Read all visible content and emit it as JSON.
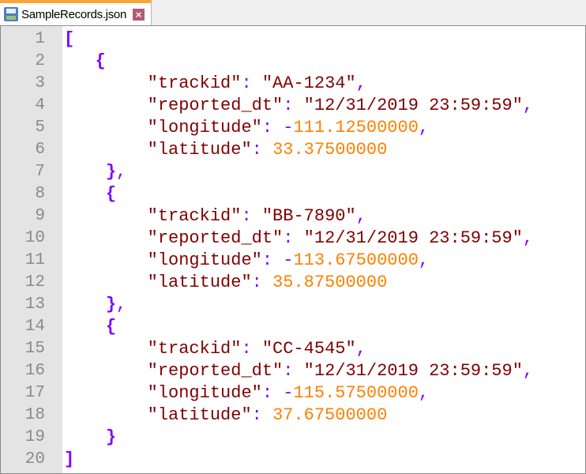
{
  "tab": {
    "title": "SampleRecords.json",
    "icon": "save-disk-icon",
    "close_icon": "close-icon"
  },
  "colors": {
    "brace": "#8000ff",
    "string": "#800000",
    "number": "#ff8000",
    "tab_accent": "#f9a43a"
  },
  "lines": [
    {
      "n": "1",
      "tokens": [
        [
          "brace",
          "["
        ]
      ]
    },
    {
      "n": "2",
      "tokens": [
        [
          "plain",
          "   "
        ],
        [
          "brace",
          "{"
        ]
      ]
    },
    {
      "n": "3",
      "tokens": [
        [
          "plain",
          "        "
        ],
        [
          "key",
          "\"trackid\""
        ],
        [
          "punc",
          ": "
        ],
        [
          "str",
          "\"AA-1234\""
        ],
        [
          "punc",
          ","
        ]
      ]
    },
    {
      "n": "4",
      "tokens": [
        [
          "plain",
          "        "
        ],
        [
          "key",
          "\"reported_dt\""
        ],
        [
          "punc",
          ": "
        ],
        [
          "str",
          "\"12/31/2019 23:59:59\""
        ],
        [
          "punc",
          ","
        ]
      ]
    },
    {
      "n": "5",
      "tokens": [
        [
          "plain",
          "        "
        ],
        [
          "key",
          "\"longitude\""
        ],
        [
          "punc",
          ": -"
        ],
        [
          "num",
          "111.12500000"
        ],
        [
          "punc",
          ","
        ]
      ]
    },
    {
      "n": "6",
      "tokens": [
        [
          "plain",
          "        "
        ],
        [
          "key",
          "\"latitude\""
        ],
        [
          "punc",
          ": "
        ],
        [
          "num",
          "33.37500000"
        ]
      ]
    },
    {
      "n": "7",
      "tokens": [
        [
          "plain",
          "    "
        ],
        [
          "brace",
          "}"
        ],
        [
          "punc",
          ","
        ]
      ]
    },
    {
      "n": "8",
      "tokens": [
        [
          "plain",
          "    "
        ],
        [
          "brace",
          "{"
        ]
      ]
    },
    {
      "n": "9",
      "tokens": [
        [
          "plain",
          "        "
        ],
        [
          "key",
          "\"trackid\""
        ],
        [
          "punc",
          ": "
        ],
        [
          "str",
          "\"BB-7890\""
        ],
        [
          "punc",
          ","
        ]
      ]
    },
    {
      "n": "10",
      "tokens": [
        [
          "plain",
          "        "
        ],
        [
          "key",
          "\"reported_dt\""
        ],
        [
          "punc",
          ": "
        ],
        [
          "str",
          "\"12/31/2019 23:59:59\""
        ],
        [
          "punc",
          ","
        ]
      ]
    },
    {
      "n": "11",
      "tokens": [
        [
          "plain",
          "        "
        ],
        [
          "key",
          "\"longitude\""
        ],
        [
          "punc",
          ": -"
        ],
        [
          "num",
          "113.67500000"
        ],
        [
          "punc",
          ","
        ]
      ]
    },
    {
      "n": "12",
      "tokens": [
        [
          "plain",
          "        "
        ],
        [
          "key",
          "\"latitude\""
        ],
        [
          "punc",
          ": "
        ],
        [
          "num",
          "35.87500000"
        ]
      ]
    },
    {
      "n": "13",
      "tokens": [
        [
          "plain",
          "    "
        ],
        [
          "brace",
          "}"
        ],
        [
          "punc",
          ","
        ]
      ]
    },
    {
      "n": "14",
      "tokens": [
        [
          "plain",
          "    "
        ],
        [
          "brace",
          "{"
        ]
      ]
    },
    {
      "n": "15",
      "tokens": [
        [
          "plain",
          "        "
        ],
        [
          "key",
          "\"trackid\""
        ],
        [
          "punc",
          ": "
        ],
        [
          "str",
          "\"CC-4545\""
        ],
        [
          "punc",
          ","
        ]
      ]
    },
    {
      "n": "16",
      "tokens": [
        [
          "plain",
          "        "
        ],
        [
          "key",
          "\"reported_dt\""
        ],
        [
          "punc",
          ": "
        ],
        [
          "str",
          "\"12/31/2019 23:59:59\""
        ],
        [
          "punc",
          ","
        ]
      ]
    },
    {
      "n": "17",
      "tokens": [
        [
          "plain",
          "        "
        ],
        [
          "key",
          "\"longitude\""
        ],
        [
          "punc",
          ": -"
        ],
        [
          "num",
          "115.57500000"
        ],
        [
          "punc",
          ","
        ]
      ]
    },
    {
      "n": "18",
      "tokens": [
        [
          "plain",
          "        "
        ],
        [
          "key",
          "\"latitude\""
        ],
        [
          "punc",
          ": "
        ],
        [
          "num",
          "37.67500000"
        ]
      ]
    },
    {
      "n": "19",
      "tokens": [
        [
          "plain",
          "    "
        ],
        [
          "brace",
          "}"
        ]
      ]
    },
    {
      "n": "20",
      "tokens": [
        [
          "brace",
          "]"
        ]
      ]
    }
  ]
}
